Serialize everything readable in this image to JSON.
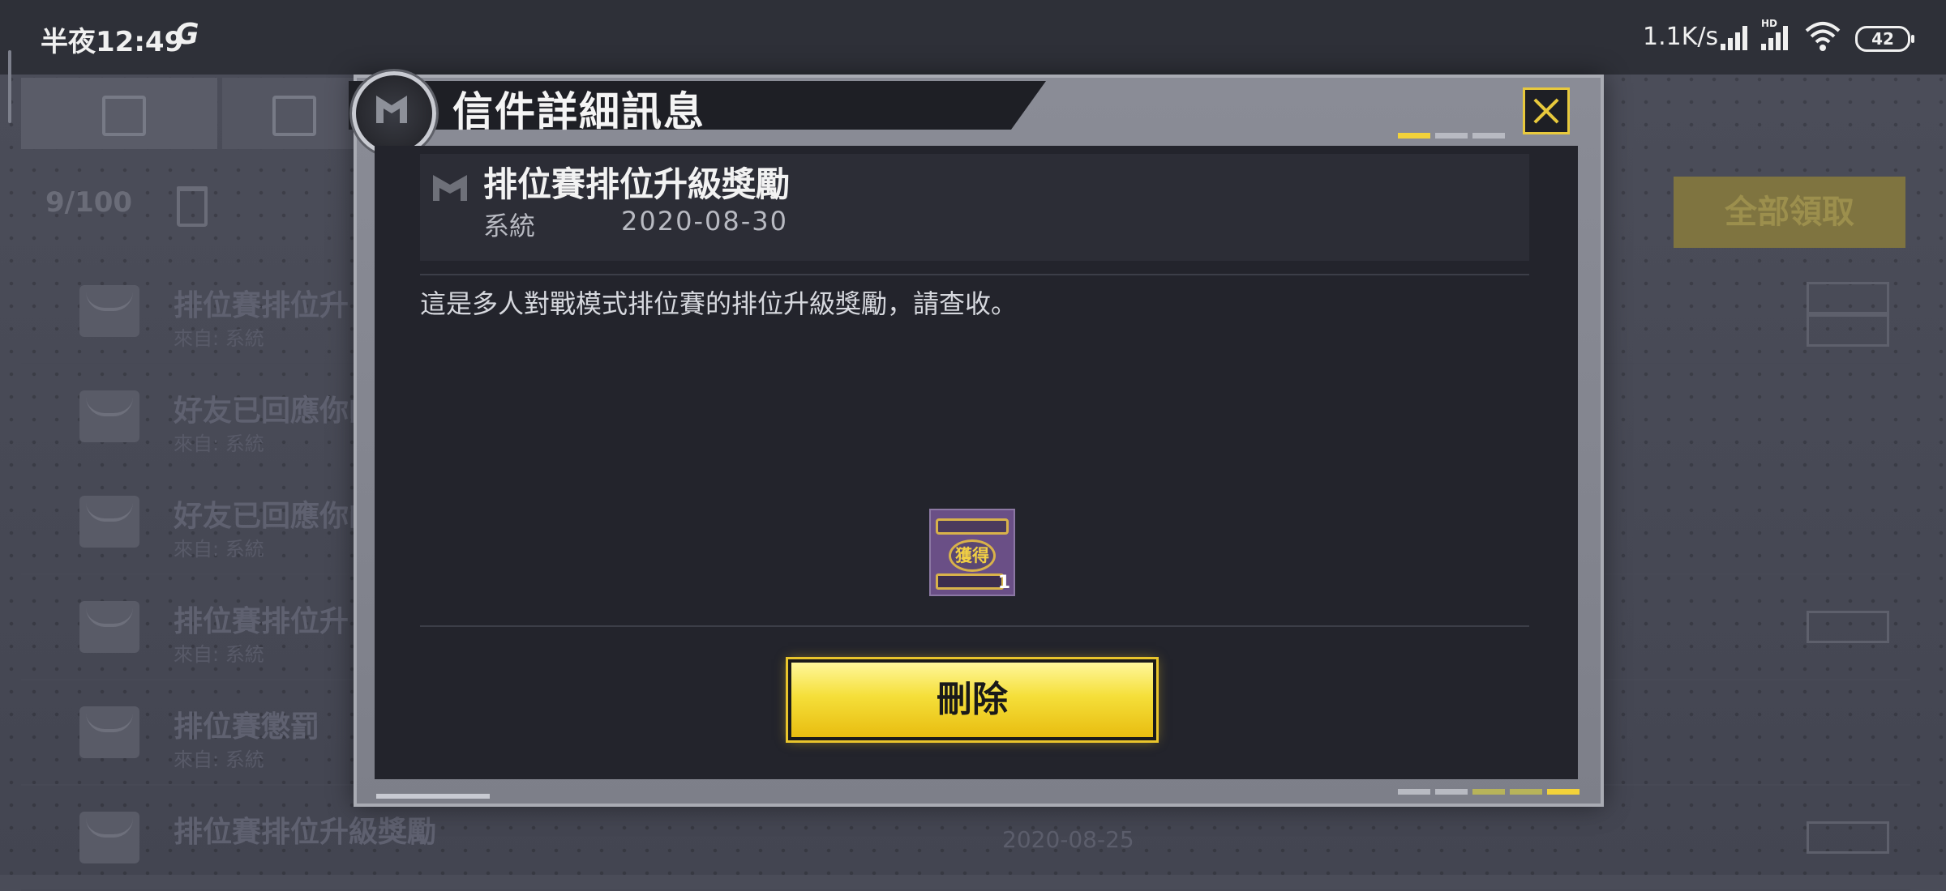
{
  "status_bar": {
    "time": "半夜12:49",
    "carrier_icon": "G",
    "net_speed": "1.1K/s",
    "hd_label": "HD",
    "battery": "42"
  },
  "background": {
    "mail_count": "9/100",
    "claim_all_label": "全部領取",
    "rows": [
      {
        "title": "排位賽排位升",
        "from": "來自: 系統"
      },
      {
        "title": "好友已回應你的",
        "from": "來自: 系統"
      },
      {
        "title": "好友已回應你的",
        "from": "來自: 系統"
      },
      {
        "title": "排位賽排位升",
        "from": "來自: 系統"
      },
      {
        "title": "排位賽懲罰",
        "from": "來自: 系統"
      },
      {
        "title": "排位賽排位升級獎勵",
        "from": ""
      }
    ],
    "last_row_date": "2020-08-25"
  },
  "dialog": {
    "title": "信件詳細訊息",
    "mail": {
      "subject": "排位賽排位升級獎勵",
      "sender": "系統",
      "date": "2020-08-30",
      "body": "這是多人對戰模式排位賽的排位升級獎勵，請查收。"
    },
    "reward": {
      "status_label": "獲得",
      "quantity": "1"
    },
    "delete_label": "刪除"
  },
  "colors": {
    "accent_yellow": "#f2d23a",
    "dialog_bg": "#23242c",
    "frame": "#8a8c96"
  }
}
